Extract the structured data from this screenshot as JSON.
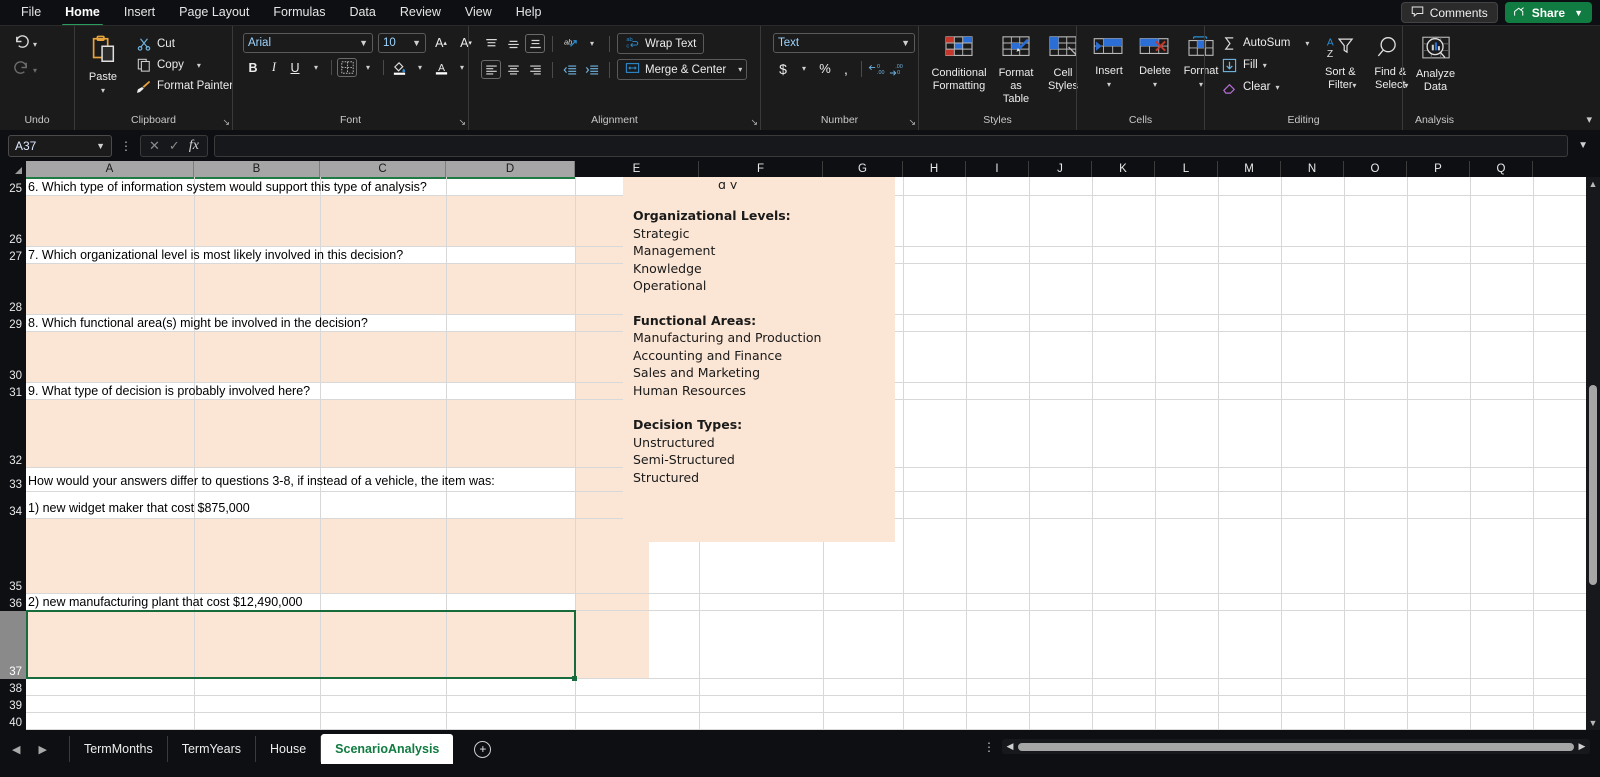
{
  "menu": {
    "tabs": [
      "File",
      "Home",
      "Insert",
      "Page Layout",
      "Formulas",
      "Data",
      "Review",
      "View",
      "Help"
    ],
    "active": "Home",
    "comments_label": "Comments",
    "share_label": "Share"
  },
  "ribbon": {
    "undo": {
      "label": "Undo"
    },
    "clipboard": {
      "label": "Clipboard",
      "paste": "Paste",
      "cut": "Cut",
      "copy": "Copy",
      "format_painter": "Format Painter"
    },
    "font": {
      "label": "Font",
      "family": "Arial",
      "size": "10"
    },
    "alignment": {
      "label": "Alignment",
      "wrap_text": "Wrap Text",
      "merge_center": "Merge & Center"
    },
    "number": {
      "label": "Number",
      "format": "Text"
    },
    "styles": {
      "label": "Styles",
      "conditional_formatting": "Conditional",
      "conditional_formatting2": "Formatting",
      "format_as_table": "Format as",
      "format_as_table2": "Table",
      "cell_styles": "Cell",
      "cell_styles2": "Styles"
    },
    "cells": {
      "label": "Cells",
      "insert": "Insert",
      "delete": "Delete",
      "format": "Format"
    },
    "editing": {
      "label": "Editing",
      "autosum": "AutoSum",
      "fill": "Fill",
      "clear": "Clear",
      "sort_filter": "Sort &",
      "sort_filter2": "Filter",
      "find_select": "Find &",
      "find_select2": "Select"
    },
    "analysis": {
      "label": "Analysis",
      "analyze_data": "Analyze",
      "analyze_data2": "Data"
    }
  },
  "formula_bar": {
    "name_box": "A37",
    "formula": ""
  },
  "grid": {
    "columns": [
      "A",
      "B",
      "C",
      "D",
      "E",
      "F",
      "G",
      "H",
      "I",
      "J",
      "K",
      "L",
      "M",
      "N",
      "O",
      "P",
      "Q"
    ],
    "selected_column_range": [
      "A",
      "B",
      "C",
      "D"
    ],
    "rows": [
      "25",
      "26",
      "27",
      "28",
      "29",
      "30",
      "31",
      "32",
      "33",
      "34",
      "35",
      "36",
      "37",
      "38",
      "39",
      "40"
    ],
    "selected_row": "37",
    "cells": [
      {
        "ref": "A25",
        "text": "6. Which type of information system would support this type of analysis?"
      },
      {
        "ref": "A27",
        "text": "7. Which organizational level is most likely involved in this decision?"
      },
      {
        "ref": "A29",
        "text": "8. Which functional area(s) might be involved in the decision?"
      },
      {
        "ref": "A31",
        "text": "9. What type of decision is probably involved here?"
      },
      {
        "ref": "A33",
        "text": "How would your answers differ to questions 3-8, if instead of a vehicle, the item was:"
      },
      {
        "ref": "A34",
        "text": "   1) new widget maker that cost $875,000"
      },
      {
        "ref": "A36",
        "text": "   2) new manufacturing plant that cost $12,490,000"
      },
      {
        "ref": "A37",
        "text": ""
      }
    ]
  },
  "note_box": {
    "clipped_top": "g  y",
    "sections": [
      {
        "heading": "Organizational Levels:",
        "items": [
          "Strategic",
          "Management",
          "Knowledge",
          "Operational"
        ]
      },
      {
        "heading": "Functional Areas:",
        "items": [
          "Manufacturing and Production",
          "Accounting and Finance",
          "Sales and Marketing",
          "Human Resources"
        ]
      },
      {
        "heading": "Decision Types:",
        "items": [
          "Unstructured",
          "Semi-Structured",
          "Structured"
        ]
      }
    ]
  },
  "sheet_tabs": {
    "tabs": [
      "TermMonths",
      "TermYears",
      "House",
      "ScenarioAnalysis"
    ],
    "active": "ScenarioAnalysis",
    "add_label": "+"
  },
  "colors": {
    "accent_green": "#107c41",
    "cell_fill": "#fbe5d4",
    "selection_border": "#186b3a"
  }
}
